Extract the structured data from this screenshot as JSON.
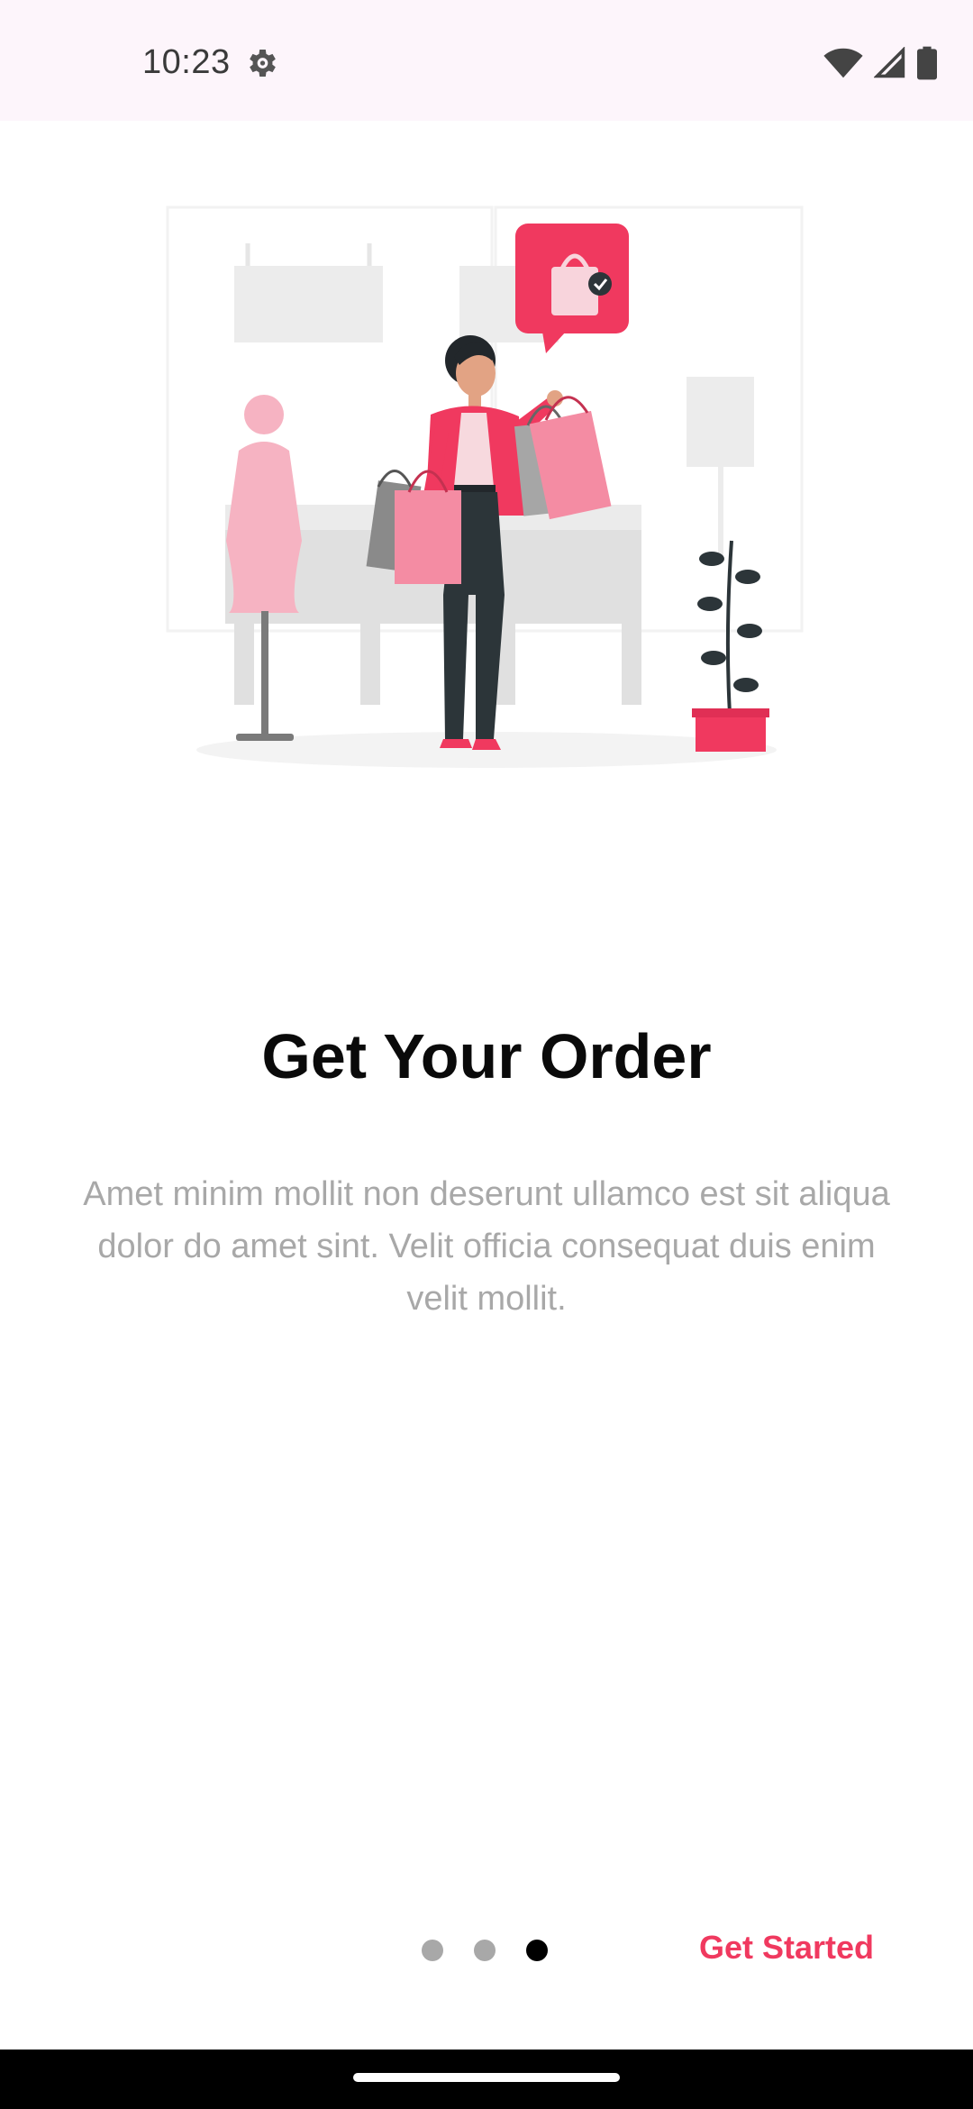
{
  "status_bar": {
    "time": "10:23",
    "icons": [
      "settings-gear-icon",
      "wifi-icon",
      "cellular-signal-icon",
      "battery-icon"
    ]
  },
  "onboarding": {
    "title": "Get Your Order",
    "description": "Amet minim mollit non deserunt ullamco est sit aliqua dolor do amet sint. Velit officia consequat duis enim velit mollit.",
    "page_indicator": {
      "total": 3,
      "current": 3
    },
    "get_started_label": "Get Started"
  },
  "colors": {
    "accent": "#f0395f",
    "title": "#0a0a0a",
    "description": "#a8a8a8",
    "status_bar_bg": "#fdf5fb",
    "dot_inactive": "#a8a8a8",
    "dot_active": "#000000"
  }
}
